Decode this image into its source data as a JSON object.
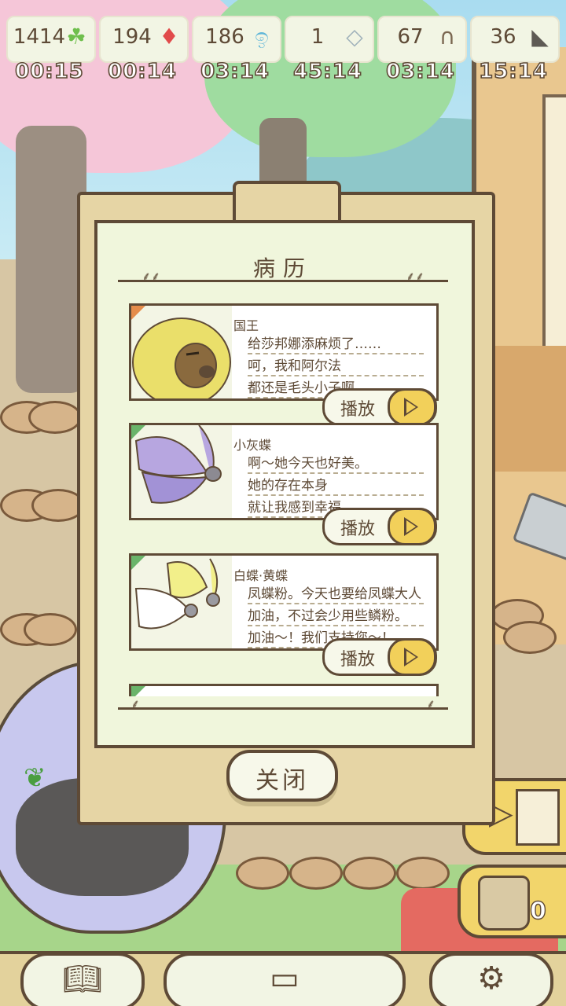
{
  "resources": [
    {
      "value": "1414",
      "icon": "clover-icon",
      "timer": "00:15",
      "color": "#6fbf4d"
    },
    {
      "value": "194",
      "icon": "red-crystal-icon",
      "timer": "00:14",
      "color": "#e14b4b"
    },
    {
      "value": "186",
      "icon": "blue-swirl-icon",
      "timer": "03:14",
      "color": "#5fb6d8"
    },
    {
      "value": "1",
      "icon": "white-crystal-icon",
      "timer": "45:14",
      "color": "#c9d4da"
    },
    {
      "value": "67",
      "icon": "horseshoe-icon",
      "timer": "03:14",
      "color": "#ffffff"
    },
    {
      "value": "36",
      "icon": "dark-horn-icon",
      "timer": "15:14",
      "color": "#5e5a54"
    }
  ],
  "panel": {
    "title": "病历",
    "close_label": "关闭",
    "records": [
      {
        "name": "国王",
        "lines": [
          "给莎邦娜添麻烦了……",
          "呵，我和阿尔法",
          "都还是毛头小子啊。"
        ],
        "play_label": "播放"
      },
      {
        "name": "小灰蝶",
        "lines": [
          "啊～她今天也好美。",
          "她的存在本身",
          "就让我感到幸福。"
        ],
        "play_label": "播放"
      },
      {
        "name": "白蝶·黄蝶",
        "lines": [
          "凤蝶粉。今天也要给凤蝶大人",
          "加油，不过会少用些鳞粉。",
          "加油～！我们支持您～！"
        ],
        "play_label": "播放"
      }
    ]
  },
  "seed_count": "0",
  "icons": {
    "book": "book-icon",
    "clipboard": "clipboard-icon",
    "settings": "gear-icon",
    "door": "door-arrow-icon",
    "seed_bag": "seed-bag-icon"
  },
  "colors": {
    "ink": "#5e4a36",
    "paper": "#f0f6dc",
    "panel": "#e6d5a5",
    "accent_yellow": "#f2d05a"
  }
}
